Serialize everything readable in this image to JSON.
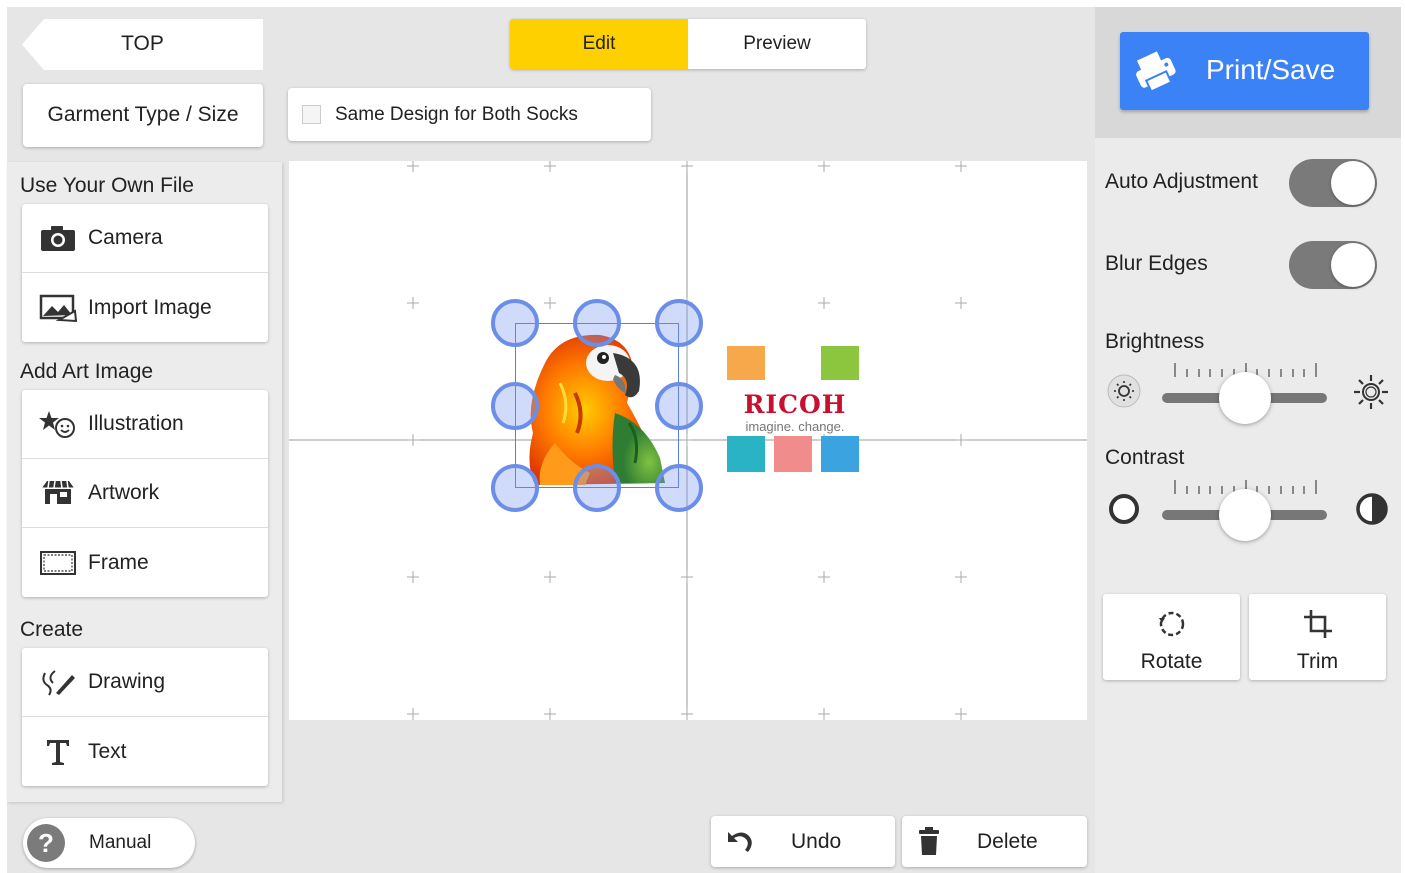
{
  "nav": {
    "top_label": "TOP",
    "garment_label": "Garment Type / Size"
  },
  "tabs": {
    "edit": "Edit",
    "preview": "Preview"
  },
  "same_design": {
    "label": "Same Design for Both Socks",
    "checked": false
  },
  "left": {
    "own_file": {
      "title": "Use Your Own File",
      "items": [
        {
          "label": "Camera",
          "icon": "camera-icon"
        },
        {
          "label": "Import Image",
          "icon": "image-icon"
        }
      ]
    },
    "art": {
      "title": "Add Art Image",
      "items": [
        {
          "label": "Illustration",
          "icon": "illustration-icon"
        },
        {
          "label": "Artwork",
          "icon": "artwork-icon"
        },
        {
          "label": "Frame",
          "icon": "frame-icon"
        }
      ]
    },
    "create": {
      "title": "Create",
      "items": [
        {
          "label": "Drawing",
          "icon": "drawing-icon"
        },
        {
          "label": "Text",
          "icon": "text-icon"
        }
      ]
    }
  },
  "canvas": {
    "logo": {
      "brand": "RICOH",
      "tagline": "imagine. change."
    },
    "colors": {
      "brand_red": "#c8102e",
      "handle": "#6b8ee8"
    }
  },
  "bottom": {
    "manual": "Manual",
    "undo": "Undo",
    "delete": "Delete"
  },
  "right": {
    "print_save": "Print/Save",
    "auto_adjustment": {
      "label": "Auto Adjustment",
      "on": true
    },
    "blur_edges": {
      "label": "Blur Edges",
      "on": true
    },
    "brightness": {
      "label": "Brightness",
      "value": 0.5
    },
    "contrast": {
      "label": "Contrast",
      "value": 0.5
    },
    "rotate": "Rotate",
    "trim": "Trim"
  },
  "theme": {
    "accent_yellow": "#ffd000",
    "print_blue": "#3b82f6",
    "toggle_gray": "#7a7a7a"
  }
}
